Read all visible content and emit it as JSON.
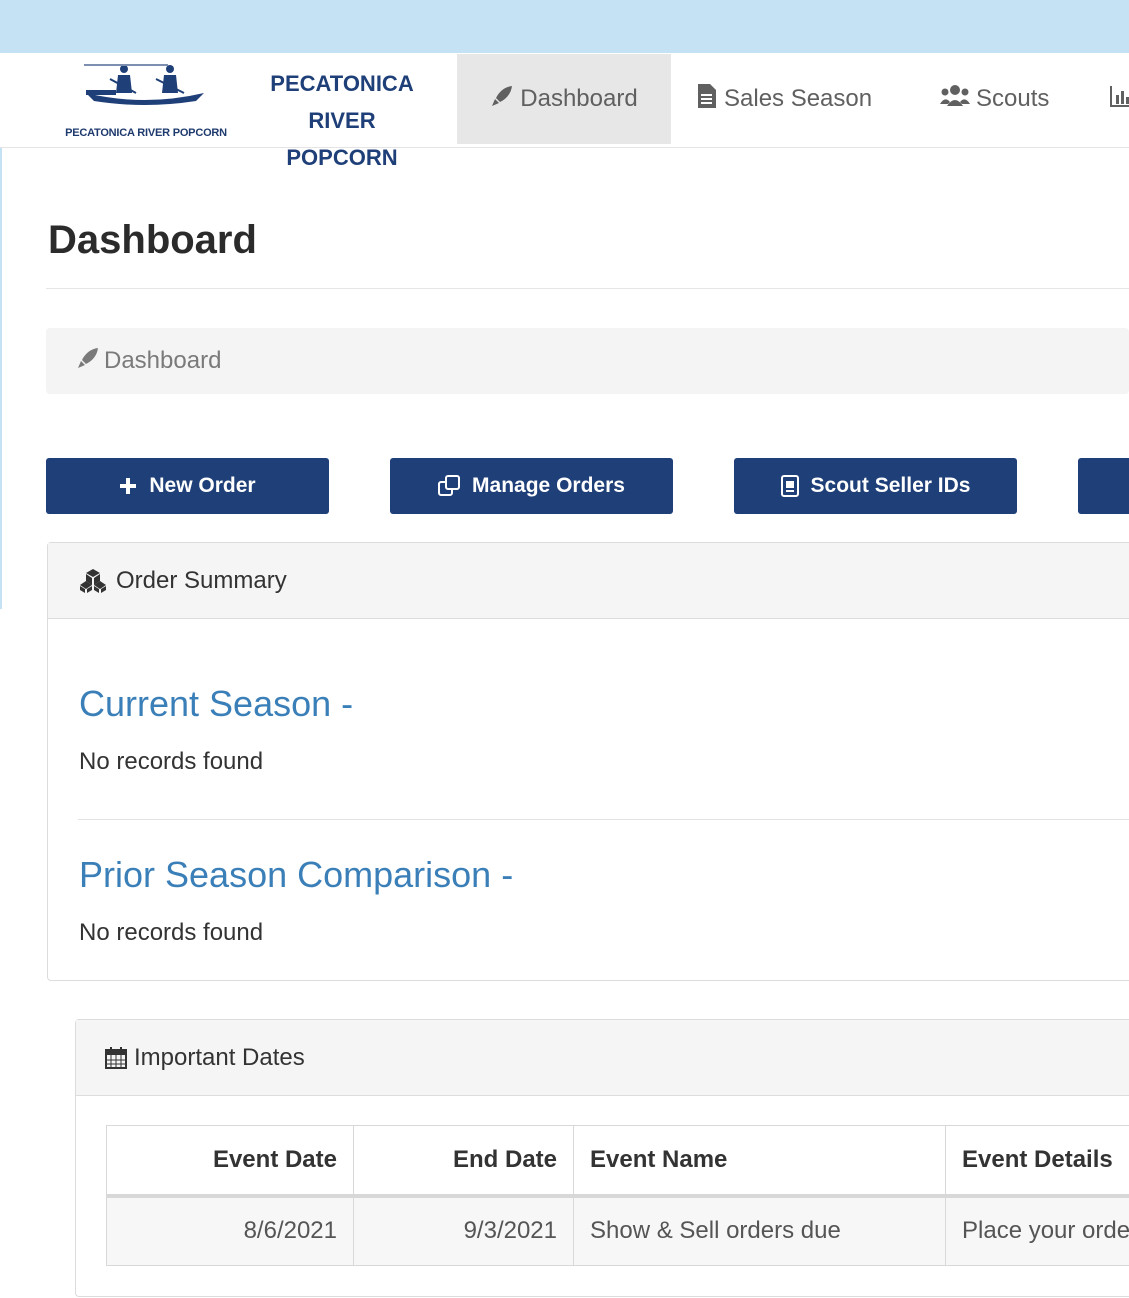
{
  "brand": {
    "caption": "PECATONICA RIVER POPCORN",
    "name": "PECATONICA RIVER POPCORN",
    "color": "#1f3f78"
  },
  "nav": {
    "items": [
      {
        "label": "Dashboard",
        "icon": "rocket-icon",
        "active": true
      },
      {
        "label": "Sales Season",
        "icon": "file-icon"
      },
      {
        "label": "Scouts",
        "icon": "users-icon"
      },
      {
        "label": "",
        "icon": "bar-chart-icon"
      }
    ]
  },
  "page": {
    "title": "Dashboard",
    "breadcrumb": "Dashboard"
  },
  "actions": [
    {
      "label": "New Order",
      "icon": "plus-icon"
    },
    {
      "label": "Manage Orders",
      "icon": "copy-icon"
    },
    {
      "label": "Scout Seller IDs",
      "icon": "id-card-icon"
    }
  ],
  "order_summary": {
    "title": "Order Summary",
    "current_season": {
      "heading": "Current Season -",
      "message": "No records found"
    },
    "prior_season": {
      "heading": "Prior Season Comparison -",
      "message": "No records found"
    }
  },
  "important_dates": {
    "title": "Important Dates",
    "columns": [
      "Event Date",
      "End Date",
      "Event Name",
      "Event Details"
    ],
    "rows": [
      [
        "8/6/2021",
        "9/3/2021",
        "Show & Sell orders due",
        "Place your orde"
      ]
    ]
  },
  "colors": {
    "accent": "#1f3f78",
    "link_heading": "#3a7fb8",
    "top_strip": "#c5e2f5"
  }
}
